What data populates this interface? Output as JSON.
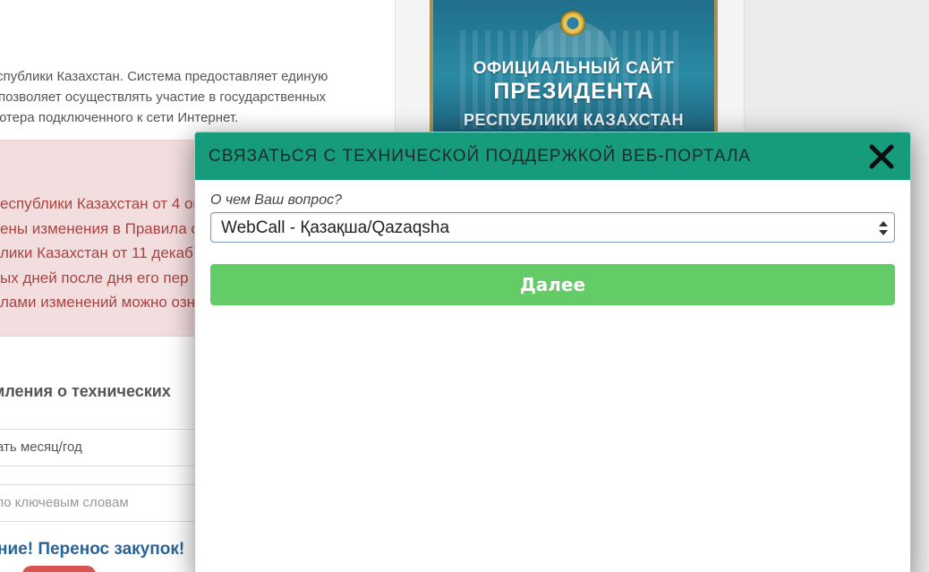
{
  "background": {
    "intro_lines": [
      "спублики Казахстан. Система предоставляет единую",
      "позволяет осуществлять участие в государственных",
      "ютера подключенного к сети Интернет."
    ],
    "alert_lines": [
      "еспублики Казахстан от 4 ок",
      "ены изменения в Правила с",
      "лики Казахстан от 11 декаб",
      "ых дней после дня его пер",
      "лами изменений можно озн"
    ],
    "section_title": "мления о технических",
    "filter_month": "ать месяц/год",
    "filter_keywords": "по ключевым словам",
    "news_title": "ние! Перенос закупок!",
    "banner": {
      "line1": "ОФИЦИАЛЬНЫЙ САЙТ",
      "line2": "ПРЕЗИДЕНТА",
      "line3": "РЕСПУБЛИКИ КАЗАХСТАН"
    }
  },
  "modal": {
    "title": "СВЯЗАТЬСЯ С ТЕХНИЧЕСКОЙ ПОДДЕРЖКОЙ ВЕБ-ПОРТАЛА",
    "question_label": "О чем Ваш вопрос?",
    "select_value": "WebCall - Қазақша/Qazaqsha",
    "next_button": "Далее",
    "close_icon": "close-icon",
    "colors": {
      "header": "#169b7d",
      "button": "#63cc67",
      "select_border": "#7a9bc9"
    }
  }
}
